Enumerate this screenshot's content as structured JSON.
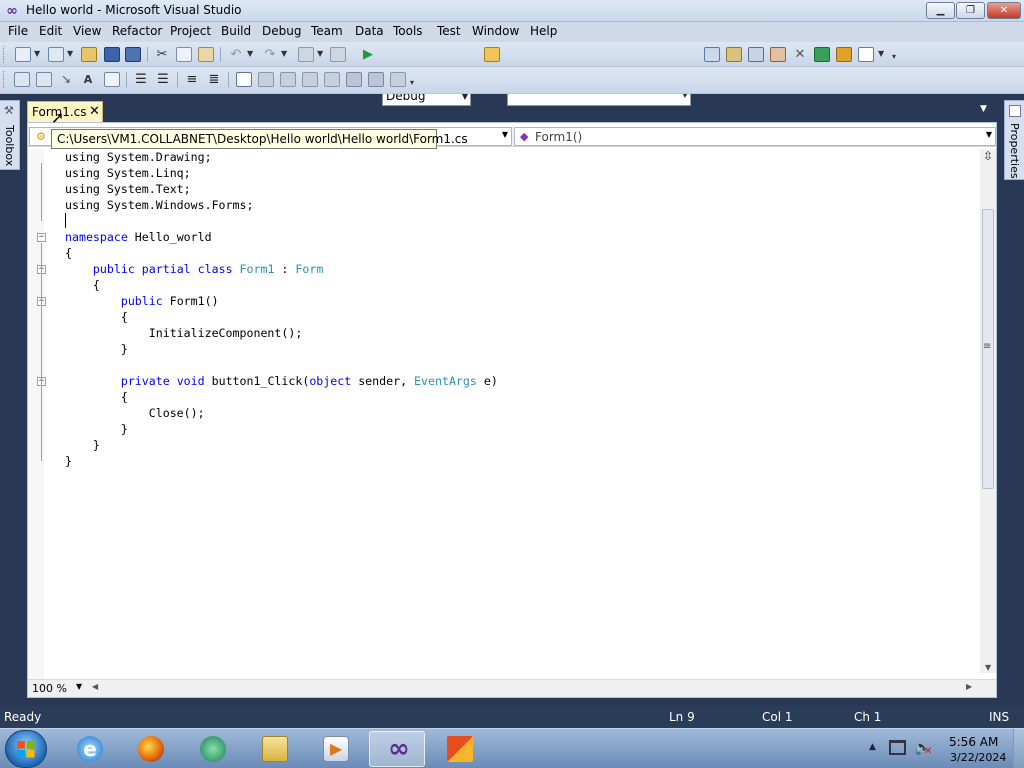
{
  "window": {
    "title": "Hello world - Microsoft Visual Studio",
    "app_icon": "∞",
    "min_glyph": "▁",
    "max_glyph": "❐",
    "close_glyph": "✕"
  },
  "menu": {
    "items": [
      {
        "label": "File"
      },
      {
        "label": "Edit"
      },
      {
        "label": "View"
      },
      {
        "label": "Refactor"
      },
      {
        "label": "Project"
      },
      {
        "label": "Build"
      },
      {
        "label": "Debug"
      },
      {
        "label": "Team"
      },
      {
        "label": "Data"
      },
      {
        "label": "Tools"
      },
      {
        "label": "Test"
      },
      {
        "label": "Window"
      },
      {
        "label": "Help"
      }
    ]
  },
  "toolbar": {
    "configuration": "Debug",
    "platform": ""
  },
  "side_panels": {
    "toolbox": "Toolbox",
    "properties": "Properties"
  },
  "document": {
    "tab_label": "Form1.cs",
    "tab_close": "✕",
    "tooltip": "C:\\Users\\VM1.COLLABNET\\Desktop\\Hello world\\Hello world\\Form1.cs",
    "nav_member": "Form1()"
  },
  "code": {
    "lines": [
      [
        {
          "t": "using System.Drawing;"
        }
      ],
      [
        {
          "t": "using System.Linq;"
        }
      ],
      [
        {
          "t": "using System.Text;"
        }
      ],
      [
        {
          "t": "using System.Windows.Forms;"
        }
      ],
      [
        {
          "t": ""
        }
      ],
      [
        {
          "t": "namespace",
          "c": "kw"
        },
        {
          "t": " Hello_world"
        }
      ],
      [
        {
          "t": "{"
        }
      ],
      [
        {
          "t": "    "
        },
        {
          "t": "public",
          "c": "kw"
        },
        {
          "t": " "
        },
        {
          "t": "partial",
          "c": "kw"
        },
        {
          "t": " "
        },
        {
          "t": "class",
          "c": "kw"
        },
        {
          "t": " "
        },
        {
          "t": "Form1",
          "c": "ty"
        },
        {
          "t": " : "
        },
        {
          "t": "Form",
          "c": "ty"
        }
      ],
      [
        {
          "t": "    {"
        }
      ],
      [
        {
          "t": "        "
        },
        {
          "t": "public",
          "c": "kw"
        },
        {
          "t": " Form1()"
        }
      ],
      [
        {
          "t": "        {"
        }
      ],
      [
        {
          "t": "            InitializeComponent();"
        }
      ],
      [
        {
          "t": "        }"
        }
      ],
      [
        {
          "t": ""
        }
      ],
      [
        {
          "t": "        "
        },
        {
          "t": "private",
          "c": "kw"
        },
        {
          "t": " "
        },
        {
          "t": "void",
          "c": "kw"
        },
        {
          "t": " button1_Click("
        },
        {
          "t": "object",
          "c": "kw"
        },
        {
          "t": " sender, "
        },
        {
          "t": "EventArgs",
          "c": "ty"
        },
        {
          "t": " e)"
        }
      ],
      [
        {
          "t": "        {"
        }
      ],
      [
        {
          "t": "            Close();"
        }
      ],
      [
        {
          "t": "        }"
        }
      ],
      [
        {
          "t": "    }"
        }
      ],
      [
        {
          "t": "}"
        }
      ]
    ],
    "keyword_color": "#0000ff",
    "type_color": "#2b91af"
  },
  "editor": {
    "zoom": "100 %"
  },
  "status": {
    "text": "Ready",
    "line": "Ln 9",
    "col": "Col 1",
    "ch": "Ch 1",
    "mode": "INS"
  },
  "taskbar": {
    "items": [
      {
        "name": "internet-explorer-icon"
      },
      {
        "name": "firefox-icon"
      },
      {
        "name": "media-center-icon"
      },
      {
        "name": "file-explorer-icon"
      },
      {
        "name": "media-player-icon"
      },
      {
        "name": "visual-studio-icon"
      },
      {
        "name": "office-icon"
      }
    ],
    "time": "5:56 AM",
    "date": "3/22/2024"
  }
}
